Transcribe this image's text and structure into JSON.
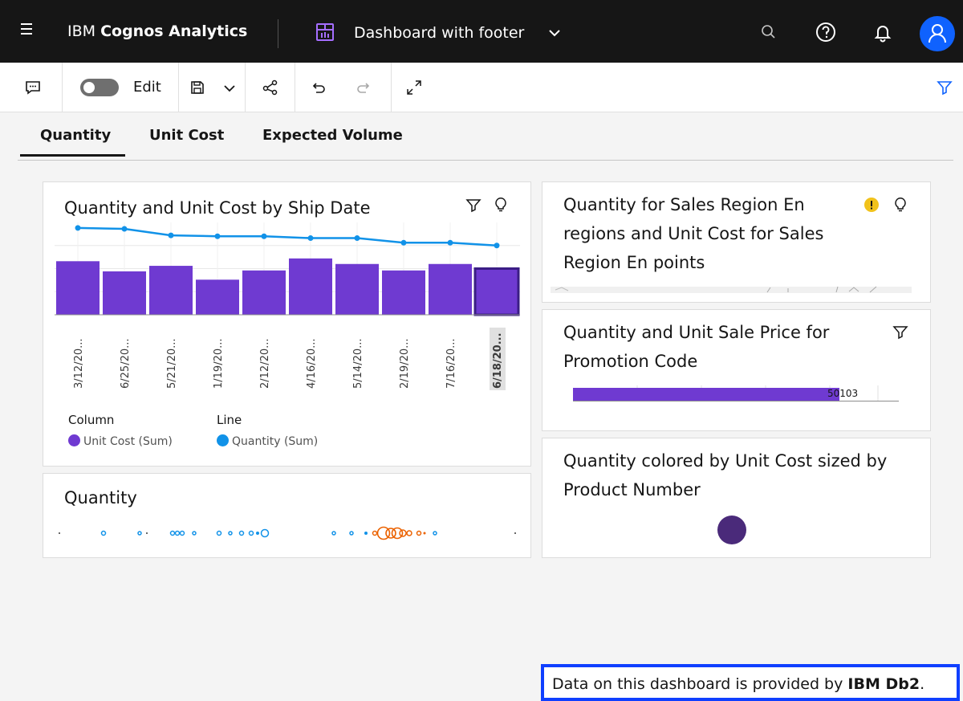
{
  "header": {
    "brand_prefix": "IBM ",
    "brand_name": "Cognos Analytics",
    "dashboard_title": "Dashboard with footer",
    "icons": [
      "menu-icon",
      "dashboard-icon",
      "chevron-down-icon",
      "search-icon",
      "help-icon",
      "notification-icon",
      "user-avatar-icon"
    ]
  },
  "toolbar": {
    "edit_label": "Edit",
    "icons": [
      "comment-icon",
      "toggle",
      "save-icon",
      "chevron-down-icon",
      "share-icon",
      "undo-icon",
      "redo-icon",
      "fullscreen-icon",
      "filter-icon"
    ]
  },
  "tabs": [
    {
      "label": "Quantity",
      "active": true
    },
    {
      "label": "Unit Cost",
      "active": false
    },
    {
      "label": "Expected Volume",
      "active": false
    }
  ],
  "widgets": {
    "combo": {
      "title": "Quantity and Unit Cost by Ship Date",
      "legend_column_caption": "Column",
      "legend_line_caption": "Line",
      "legend_column_series": "Unit Cost (Sum)",
      "legend_line_series": "Quantity (Sum)"
    },
    "region": {
      "title_line1": "Quantity for Sales Region En",
      "title_line2": "regions and Unit Cost for Sales",
      "title_line3": "Region En points"
    },
    "promo": {
      "title_line1": "Quantity and Unit Sale Price for",
      "title_line2": "Promotion Code",
      "bar_label": "50103"
    },
    "quantity_strip": {
      "title": "Quantity"
    },
    "bubble": {
      "title_line1": "Quantity colored by Unit Cost sized by",
      "title_line2": "Product Number"
    }
  },
  "footer": {
    "text_prefix": "Data on this dashboard is provided by ",
    "text_bold": "IBM Db2",
    "text_suffix": "."
  },
  "colors": {
    "column": "#6f3ad1",
    "line": "#1192e8",
    "orange": "#eb6200",
    "bubble": "#4a2a7a",
    "warning": "#f1c21b"
  },
  "chart_data": {
    "type": "bar",
    "categories": [
      "3/12/20...",
      "6/25/20...",
      "5/21/20...",
      "1/19/20...",
      "2/12/20...",
      "4/16/20...",
      "5/14/20...",
      "2/19/20...",
      "7/16/20...",
      "6/18/20..."
    ],
    "series": [
      {
        "name": "Unit Cost (Sum)",
        "type": "column",
        "values": [
          58,
          47,
          53,
          38,
          48,
          61,
          55,
          48,
          55,
          50
        ]
      },
      {
        "name": "Quantity (Sum)",
        "type": "line",
        "values": [
          94,
          93,
          86,
          85,
          85,
          83,
          83,
          78,
          78,
          75
        ]
      }
    ],
    "selected_category": "6/18/20...",
    "ylim": [
      0,
      100
    ],
    "grid": true,
    "legend": "bottom"
  }
}
